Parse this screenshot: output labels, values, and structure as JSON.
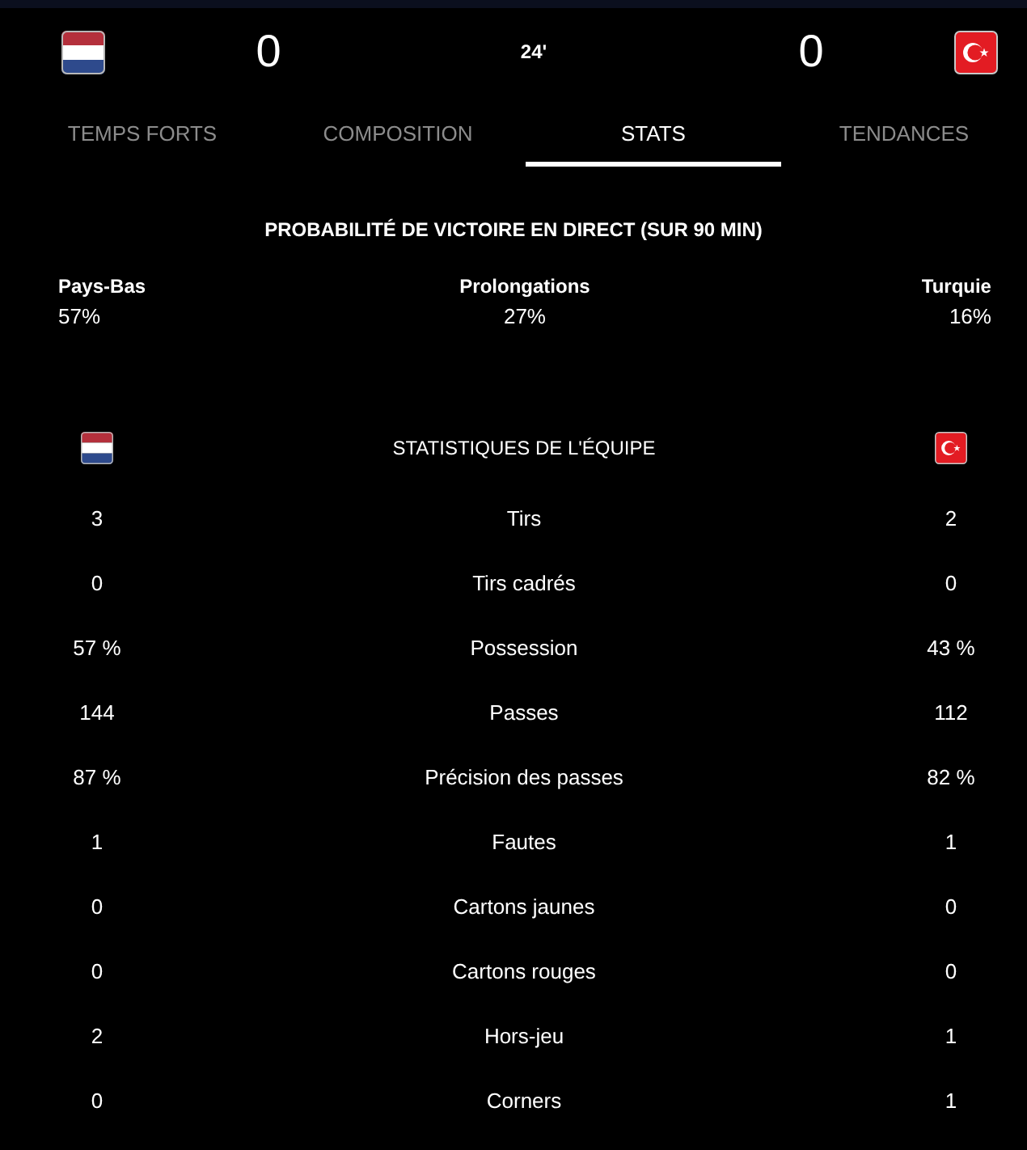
{
  "match": {
    "home": {
      "score": "0"
    },
    "minute": "24'",
    "away": {
      "score": "0"
    }
  },
  "tabs": [
    {
      "label": "TEMPS FORTS",
      "selected": false
    },
    {
      "label": "COMPOSITION",
      "selected": false
    },
    {
      "label": "STATS",
      "selected": true
    },
    {
      "label": "TENDANCES",
      "selected": false
    }
  ],
  "win_probability": {
    "title": "PROBABILITÉ DE VICTOIRE EN DIRECT (SUR 90 MIN)",
    "outcomes": [
      {
        "label": "Pays-Bas",
        "value": "57%"
      },
      {
        "label": "Prolongations",
        "value": "27%"
      },
      {
        "label": "Turquie",
        "value": "16%"
      }
    ]
  },
  "team_stats": {
    "title": "STATISTIQUES DE L'ÉQUIPE",
    "rows": [
      {
        "label": "Tirs",
        "home": "3",
        "away": "2"
      },
      {
        "label": "Tirs cadrés",
        "home": "0",
        "away": "0"
      },
      {
        "label": "Possession",
        "home": "57 %",
        "away": "43 %"
      },
      {
        "label": "Passes",
        "home": "144",
        "away": "112"
      },
      {
        "label": "Précision des passes",
        "home": "87 %",
        "away": "82 %"
      },
      {
        "label": "Fautes",
        "home": "1",
        "away": "1"
      },
      {
        "label": "Cartons jaunes",
        "home": "0",
        "away": "0"
      },
      {
        "label": "Cartons rouges",
        "home": "0",
        "away": "0"
      },
      {
        "label": "Hors-jeu",
        "home": "2",
        "away": "1"
      },
      {
        "label": "Corners",
        "home": "0",
        "away": "1"
      }
    ]
  }
}
